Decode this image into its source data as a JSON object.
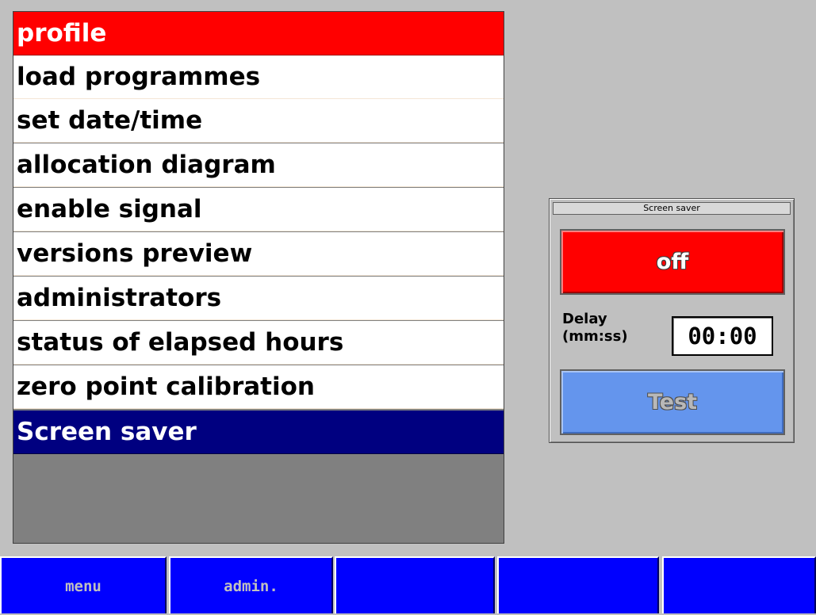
{
  "menu": {
    "items": [
      {
        "label": "profile",
        "state": "header"
      },
      {
        "label": "load programmes",
        "state": "normal"
      },
      {
        "label": "set date/time",
        "state": "normal"
      },
      {
        "label": "allocation diagram",
        "state": "normal"
      },
      {
        "label": "enable signal",
        "state": "normal"
      },
      {
        "label": "versions preview",
        "state": "normal"
      },
      {
        "label": "administrators",
        "state": "normal"
      },
      {
        "label": "status of elapsed hours",
        "state": "normal"
      },
      {
        "label": "zero point calibration",
        "state": "normal"
      },
      {
        "label": "Screen saver",
        "state": "selected"
      }
    ]
  },
  "screen_saver": {
    "title": "Screen saver",
    "toggle_label": "off",
    "delay_label_line1": "Delay",
    "delay_label_line2": "(mm:ss)",
    "delay_value": "00:00",
    "test_label": "Test"
  },
  "function_keys": [
    {
      "label": "menu"
    },
    {
      "label": "admin."
    },
    {
      "label": ""
    },
    {
      "label": ""
    },
    {
      "label": ""
    }
  ],
  "colors": {
    "header": "#ff0000",
    "selected": "#000080",
    "toggle_off": "#ff0000",
    "test_button": "#6495ed",
    "function_key": "#0000ff",
    "background": "#c0c0c0"
  }
}
